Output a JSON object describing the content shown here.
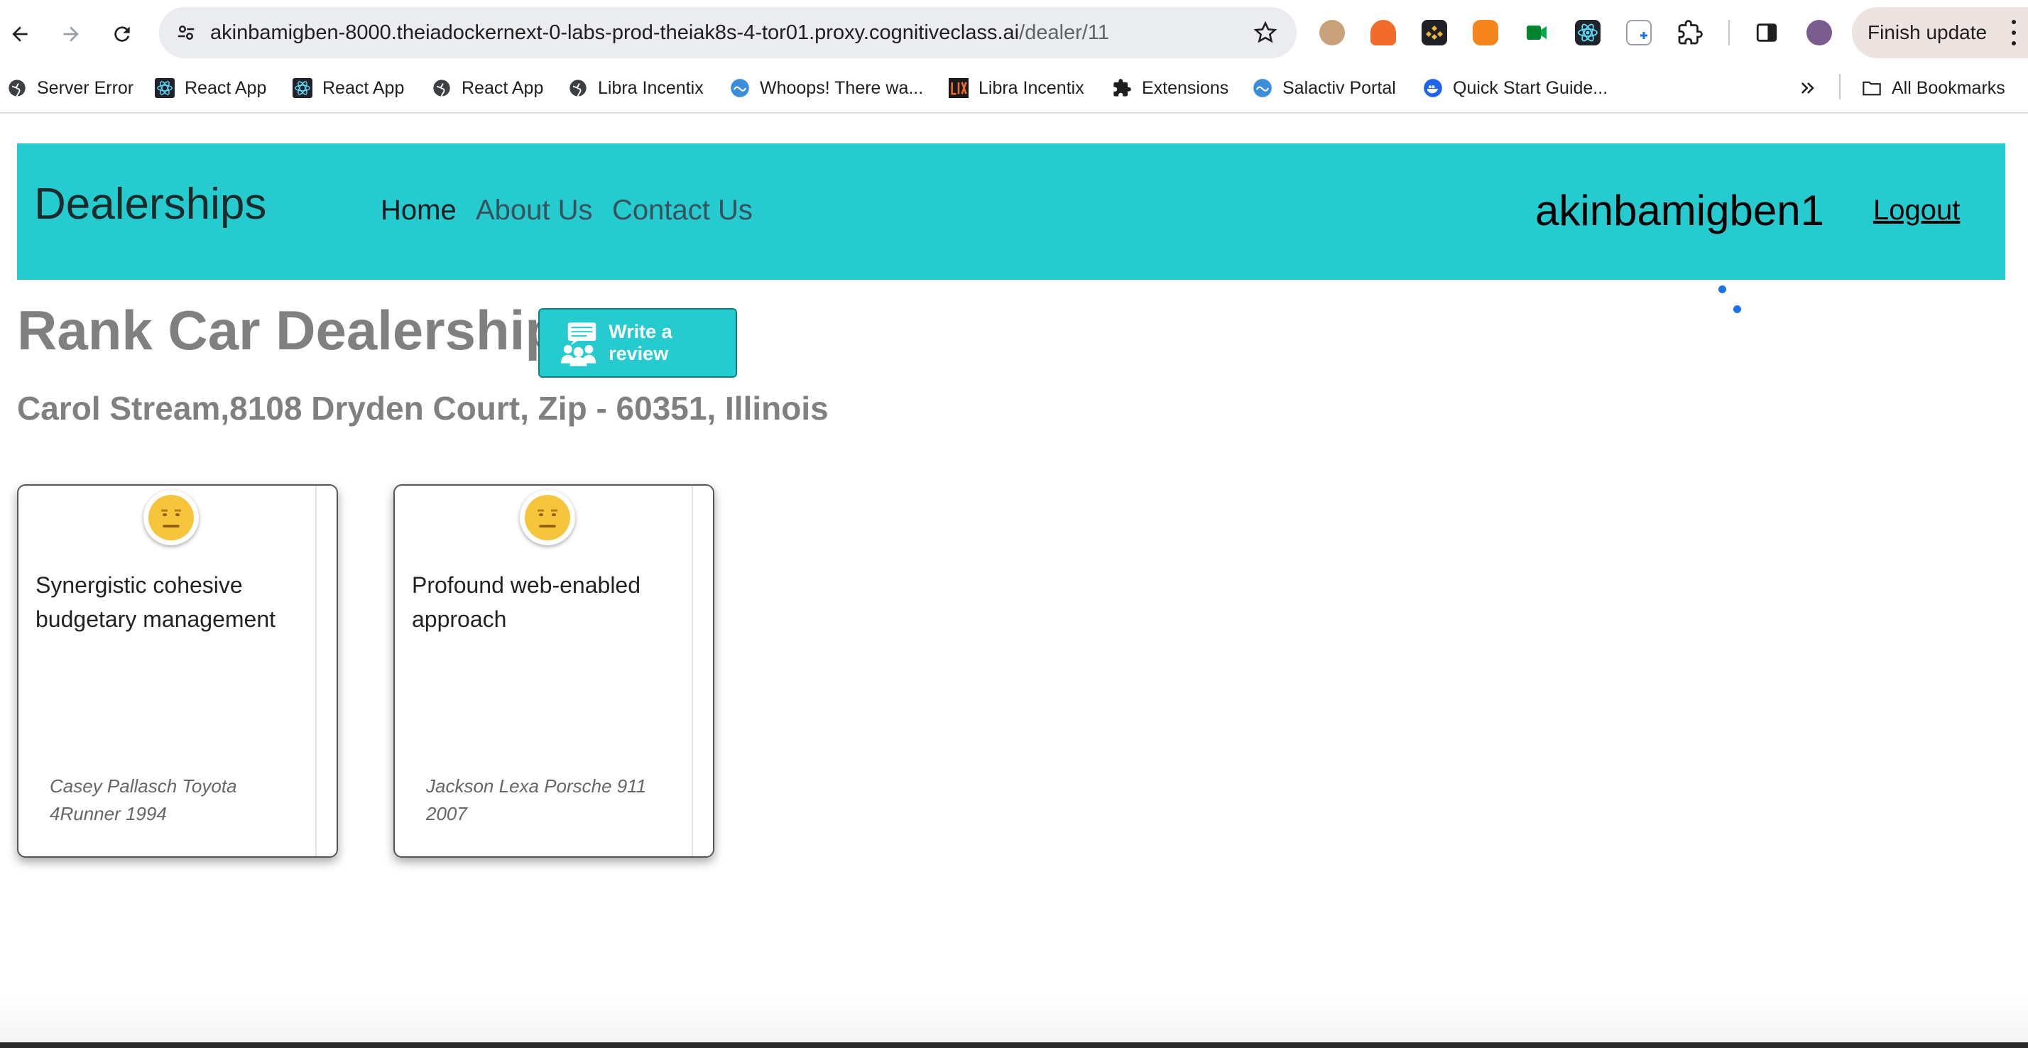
{
  "browser": {
    "url_host": "akinbamigben-8000.theiadockernext-0-labs-prod-theiak8s-4-tor01.proxy.cognitiveclass.ai",
    "url_path": "/dealer/11",
    "finish_update_label": "Finish update",
    "bookmarks": [
      {
        "label": "Server Error",
        "icon": "globe-icon"
      },
      {
        "label": "React App",
        "icon": "react-icon"
      },
      {
        "label": "React App",
        "icon": "react-icon"
      },
      {
        "label": "React App",
        "icon": "globe-icon"
      },
      {
        "label": "Libra Incentix",
        "icon": "globe-icon"
      },
      {
        "label": "Whoops! There wa...",
        "icon": "laravel-icon"
      },
      {
        "label": "Libra Incentix",
        "icon": "lix-icon"
      },
      {
        "label": "Extensions",
        "icon": "puzzle-icon"
      },
      {
        "label": "Salactiv Portal",
        "icon": "laravel-icon"
      },
      {
        "label": "Quick Start Guide...",
        "icon": "docker-icon"
      }
    ],
    "all_bookmarks_label": "All Bookmarks"
  },
  "navbar": {
    "brand": "Dealerships",
    "links": [
      "Home",
      "About Us",
      "Contact Us"
    ],
    "username": "akinbamigben1",
    "logout": "Logout"
  },
  "dealer": {
    "name": "Rank Car Dealership",
    "write_review": "Write a review",
    "address": "Carol Stream,8108 Dryden Court, Zip - 60351, Illinois"
  },
  "reviews": [
    {
      "text": "Synergistic cohesive budgetary management",
      "byline": "Casey Pallasch Toyota 4Runner 1994",
      "sentiment": "neutral-face-icon"
    },
    {
      "text": "Profound web-enabled approach",
      "byline": "Jackson Lexa Porsche 911 2007",
      "sentiment": "neutral-face-icon"
    }
  ],
  "colors": {
    "navbar_bg": "#26cbd0",
    "title_gray": "#808080",
    "emoji_yellow": "#f7c53c"
  }
}
